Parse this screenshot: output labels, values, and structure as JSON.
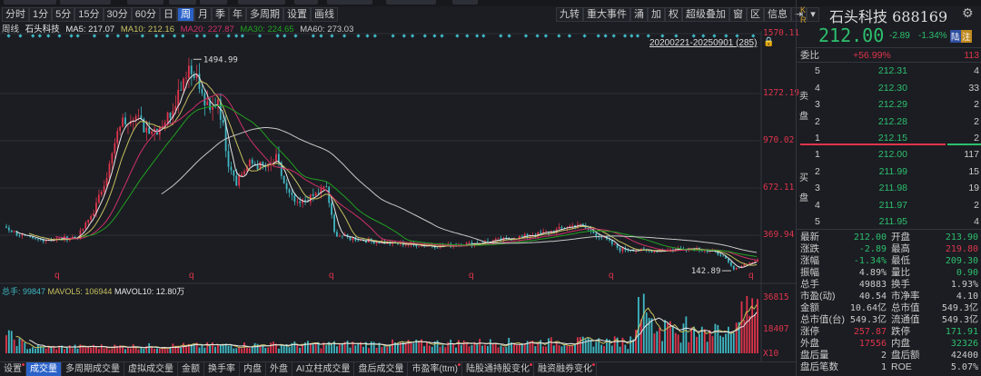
{
  "periods": [
    "分时",
    "1分",
    "5分",
    "15分",
    "30分",
    "60分",
    "日",
    "周",
    "月",
    "季",
    "年",
    "多周期",
    "设置",
    "画线"
  ],
  "active_period": "周",
  "tools": [
    "九转",
    "重大事件",
    "涌",
    "加",
    "权",
    "超级叠加",
    "窗",
    "区",
    "信息",
    "⇥",
    "▾"
  ],
  "ma_line": {
    "period": "周线",
    "name": "石头科技",
    "ma5": "MA5: 217.07",
    "ma10": "MA10: 212.16",
    "ma20": "MA20: 227.87",
    "ma30": "MA30: 224.65",
    "ma60": "MA60: 273.03"
  },
  "range_label": "20200221-20250901 (285)",
  "price_axis": [
    "1570.11",
    "1272.19",
    "970.02",
    "672.11",
    "369.94"
  ],
  "high_label": "1494.99",
  "low_label": "142.89",
  "marker_label": "q",
  "volume": {
    "total": "总手: 99847",
    "mavol5": "MAVOL5: 106944",
    "mavol10": "MAVOL10: 12.80万",
    "axis": [
      "36815",
      "18407",
      "X10"
    ]
  },
  "tabs": [
    "设置",
    "成交量",
    "多周期成交量",
    "虚拟成交量",
    "金额",
    "换手率",
    "内盘",
    "外盘",
    "AI立柱成交量",
    "盘后成交量",
    "市盈率(ttm)",
    "陆股通持股变化",
    "融资融券变化"
  ],
  "active_tab": "成交量",
  "colors": {
    "up": "#e0344c",
    "down": "#3fb8c4",
    "ma5": "#e8e8e8",
    "ma10": "#c8c060",
    "ma20": "#d0306a",
    "ma30": "#22a022",
    "ma60": "#c8c8c8"
  },
  "chart_data": {
    "type": "candlestick",
    "weeks": 285,
    "ylim": [
      142.89,
      1570.11
    ],
    "close_path": [
      [
        0,
        420
      ],
      [
        4,
        380
      ],
      [
        10,
        340
      ],
      [
        20,
        345
      ],
      [
        27,
        360
      ],
      [
        33,
        520
      ],
      [
        38,
        750
      ],
      [
        43,
        1080
      ],
      [
        48,
        1150
      ],
      [
        52,
        1060
      ],
      [
        57,
        1050
      ],
      [
        62,
        1150
      ],
      [
        67,
        1380
      ],
      [
        70,
        1494.99
      ],
      [
        74,
        1250
      ],
      [
        77,
        1150
      ],
      [
        80,
        1250
      ],
      [
        84,
        850
      ],
      [
        87,
        720
      ],
      [
        92,
        830
      ],
      [
        99,
        800
      ],
      [
        102,
        860
      ],
      [
        106,
        650
      ],
      [
        110,
        560
      ],
      [
        116,
        620
      ],
      [
        121,
        680
      ],
      [
        124,
        380
      ],
      [
        130,
        350
      ],
      [
        144,
        320
      ],
      [
        164,
        300
      ],
      [
        178,
        320
      ],
      [
        191,
        350
      ],
      [
        205,
        390
      ],
      [
        216,
        440
      ],
      [
        225,
        360
      ],
      [
        232,
        280
      ],
      [
        246,
        270
      ],
      [
        260,
        290
      ],
      [
        270,
        250
      ],
      [
        275,
        150
      ],
      [
        280,
        190
      ],
      [
        285,
        212
      ]
    ]
  },
  "quote": {
    "kr": [
      "K",
      "R"
    ],
    "name": "石头科技 688169",
    "price": "212.00",
    "change": "-2.89",
    "pct": "-1.34%",
    "tags": [
      "陆",
      "注"
    ],
    "weibi_label": "委比",
    "weibi": "+56.99%",
    "weicha": "113",
    "sell_label": [
      "卖",
      "盘"
    ],
    "buy_label": [
      "买",
      "盘"
    ],
    "asks": [
      [
        "5",
        "212.31",
        "4"
      ],
      [
        "4",
        "212.30",
        "33"
      ],
      [
        "3",
        "212.29",
        "2"
      ],
      [
        "2",
        "212.28",
        "2"
      ],
      [
        "1",
        "212.15",
        "2"
      ]
    ],
    "bids": [
      [
        "1",
        "212.00",
        "117"
      ],
      [
        "2",
        "211.99",
        "15"
      ],
      [
        "3",
        "211.98",
        "19"
      ],
      [
        "4",
        "211.97",
        "2"
      ],
      [
        "5",
        "211.95",
        "4"
      ]
    ],
    "stats": [
      [
        "最新",
        "212.00",
        "开盘",
        "213.90"
      ],
      [
        "涨跌",
        "-2.89",
        "最高",
        "219.80"
      ],
      [
        "涨幅",
        "-1.34%",
        "最低",
        "209.30"
      ],
      [
        "振幅",
        "4.89%",
        "量比",
        "0.90"
      ],
      [
        "总手",
        "49883",
        "换手",
        "1.93%"
      ],
      [
        "市盈(动)",
        "40.54",
        "市净率",
        "4.10"
      ],
      [
        "金额",
        "10.64亿",
        "总市值",
        "549.3亿"
      ],
      [
        "总市值(台)",
        "549.3亿",
        "流通值",
        "549.3亿"
      ],
      [
        "涨停",
        "257.87",
        "跌停",
        "171.91"
      ],
      [
        "外盘",
        "17556",
        "内盘",
        "32326"
      ],
      [
        "盘后量",
        "2",
        "盘后额",
        "42400"
      ],
      [
        "盘后笔数",
        "1",
        "ROE",
        "5.07%"
      ]
    ],
    "stat_colors": [
      [
        "g",
        "g"
      ],
      [
        "g",
        "r"
      ],
      [
        "g",
        "g"
      ],
      [
        "n",
        "g"
      ],
      [
        "n",
        "n"
      ],
      [
        "n",
        "n"
      ],
      [
        "n",
        "n"
      ],
      [
        "n",
        "n"
      ],
      [
        "r",
        "g"
      ],
      [
        "r",
        "g"
      ],
      [
        "n",
        "n"
      ],
      [
        "n",
        "n"
      ]
    ]
  }
}
